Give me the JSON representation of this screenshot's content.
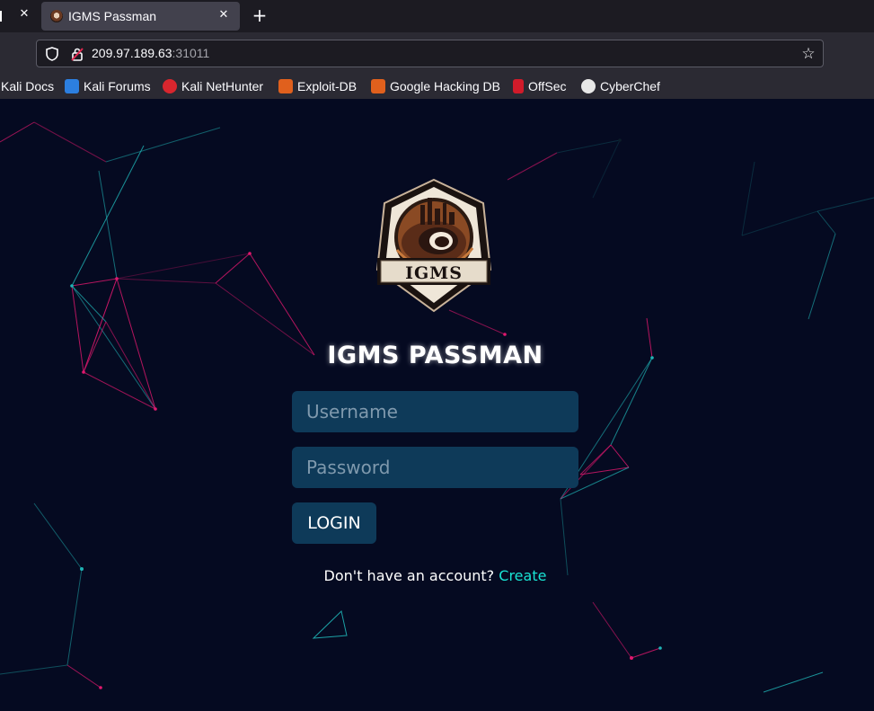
{
  "browser": {
    "active_tab_title": "IGMS Passman",
    "url_host": "209.97.189.63",
    "url_port": ":31011",
    "bookmarks": [
      {
        "label": "Kali Docs",
        "icon": "kali-icon"
      },
      {
        "label": "Kali Forums",
        "icon": "kali-forums-icon"
      },
      {
        "label": "Kali NetHunter",
        "icon": "nethunter-icon"
      },
      {
        "label": "Exploit-DB",
        "icon": "exploitdb-icon"
      },
      {
        "label": "Google Hacking DB",
        "icon": "ghdb-icon"
      },
      {
        "label": "OffSec",
        "icon": "offsec-icon"
      },
      {
        "label": "CyberChef",
        "icon": "cyberchef-icon"
      }
    ]
  },
  "login": {
    "logo_text": "IGMS",
    "title": "IGMS PASSMAN",
    "username_placeholder": "Username",
    "password_placeholder": "Password",
    "login_label": "LOGIN",
    "signup_prompt": "Don't have an account?",
    "signup_link": "Create"
  },
  "colors": {
    "page_bg": "#050a21",
    "input_bg": "#0e3a59",
    "link": "#19e3d3",
    "network_cyan": "#1fb3b5",
    "network_magenta": "#e0186e"
  }
}
